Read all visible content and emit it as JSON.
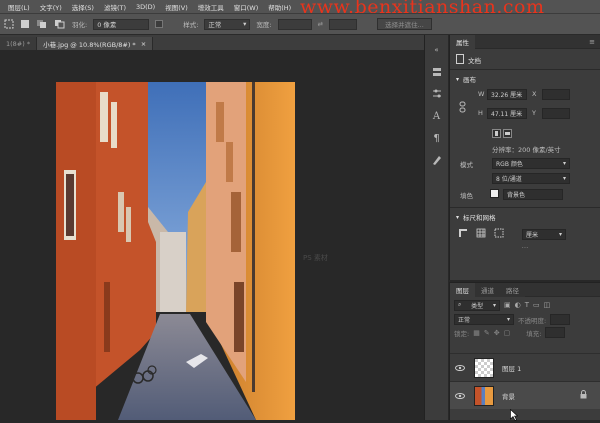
{
  "menu": {
    "items": [
      "图层(L)",
      "文字(Y)",
      "选择(S)",
      "滤镜(T)",
      "3D(D)",
      "视图(V)",
      "增效工具",
      "窗口(W)",
      "帮助(H)"
    ]
  },
  "watermark": "www.benxitianshan.com",
  "options_bar": {
    "feather_label": "羽化:",
    "feather_value": "0 像素",
    "style_label": "样式:",
    "style_value": "正常",
    "width_label": "宽度:",
    "select_mask_label": "选择并遮住..."
  },
  "tabs": [
    {
      "label": "1(8#) *",
      "active": false
    },
    {
      "label": "小巷.jpg @ 10.8%(RGB/8#) *",
      "active": true
    },
    {
      "label": "×",
      "active": false
    }
  ],
  "canvas_watermark": "PS 素材",
  "properties": {
    "panel_tab": "属性",
    "doc_label": "文档",
    "canvas_section": "画布",
    "w_label": "W",
    "w_value": "32.26 厘米",
    "x_label": "X",
    "h_label": "H",
    "h_value": "47.11 厘米",
    "y_label": "Y",
    "resolution": "分辨率：200 像素/英寸",
    "mode_label": "模式",
    "mode_value": "RGB 颜色",
    "depth_value": "8 位/通道",
    "fill_label": "填色",
    "fill_value": "背景色",
    "rulers_section": "标尺和网格",
    "units_value": "厘米"
  },
  "layers_panel": {
    "tabs": [
      "图层",
      "通道",
      "路径"
    ],
    "filter_label": "类型",
    "blend_mode": "正常",
    "opacity_label": "不透明度:",
    "lock_label": "锁定:",
    "fill_label": "填充:",
    "layers": [
      {
        "name": "图层 1",
        "visible": true,
        "locked": false
      },
      {
        "name": "背景",
        "visible": true,
        "locked": true
      }
    ]
  },
  "colors": {
    "accent": "#e8341c",
    "panel_bg": "#3c3c3c",
    "canvas_bg": "#282828"
  }
}
